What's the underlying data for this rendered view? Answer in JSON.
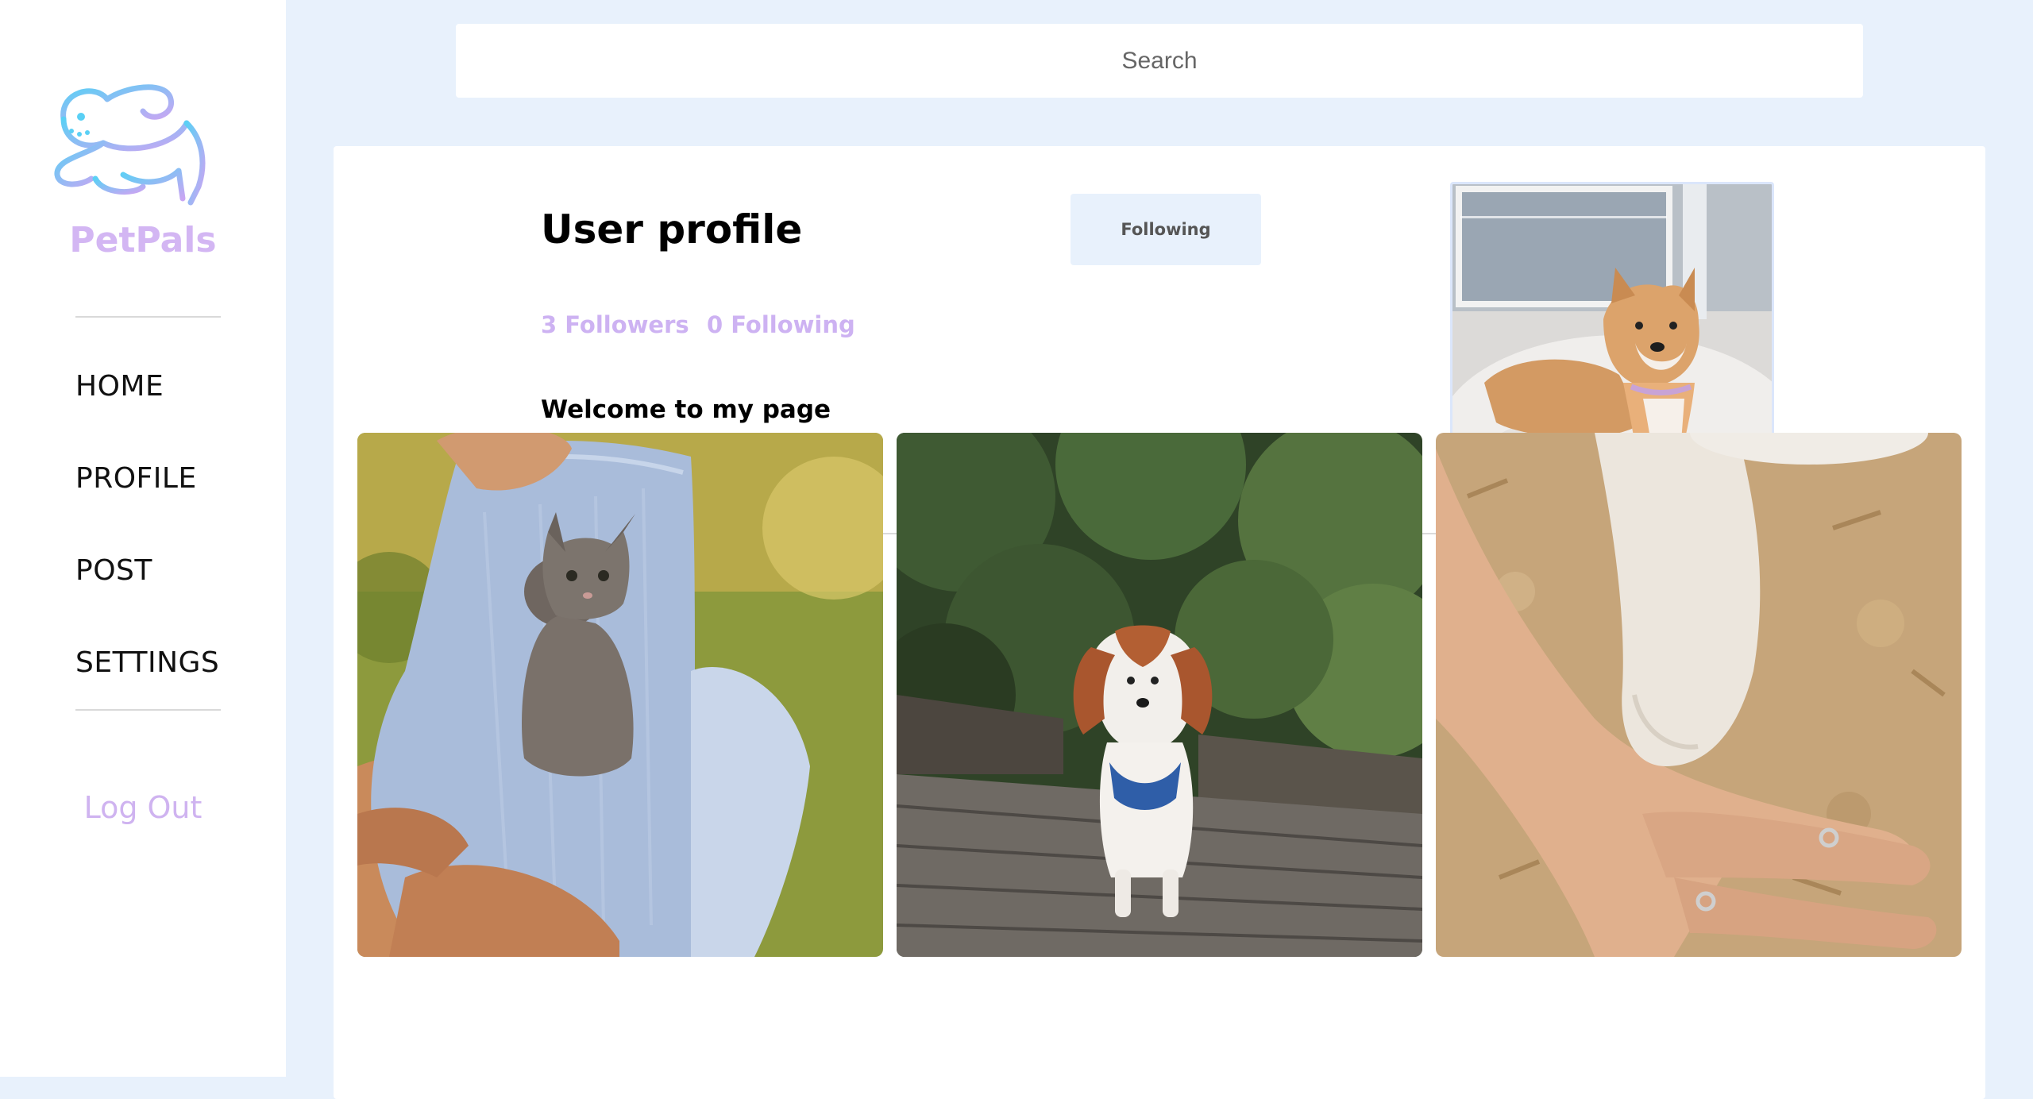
{
  "app": {
    "name": "PetPals",
    "logo_icon": "flying-dog-logo",
    "brand_color": "#d3b6f3",
    "background_color": "#e8f1fc"
  },
  "sidebar": {
    "items": [
      {
        "label": "HOME"
      },
      {
        "label": "PROFILE"
      },
      {
        "label": "POST"
      },
      {
        "label": "SETTINGS"
      }
    ],
    "logout_label": "Log Out"
  },
  "search": {
    "placeholder": "Search",
    "value": ""
  },
  "profile": {
    "title": "User profile",
    "follow_button_label": "Following",
    "followers": "3 Followers",
    "following": "0 Following",
    "bio": "Welcome to my page",
    "avatar": "shiba-inu-photo"
  },
  "posts": [
    {
      "image": "kitten-on-lap-photo"
    },
    {
      "image": "spaniel-on-boardwalk-photo"
    },
    {
      "image": "hands-and-dog-paw-photo"
    }
  ]
}
